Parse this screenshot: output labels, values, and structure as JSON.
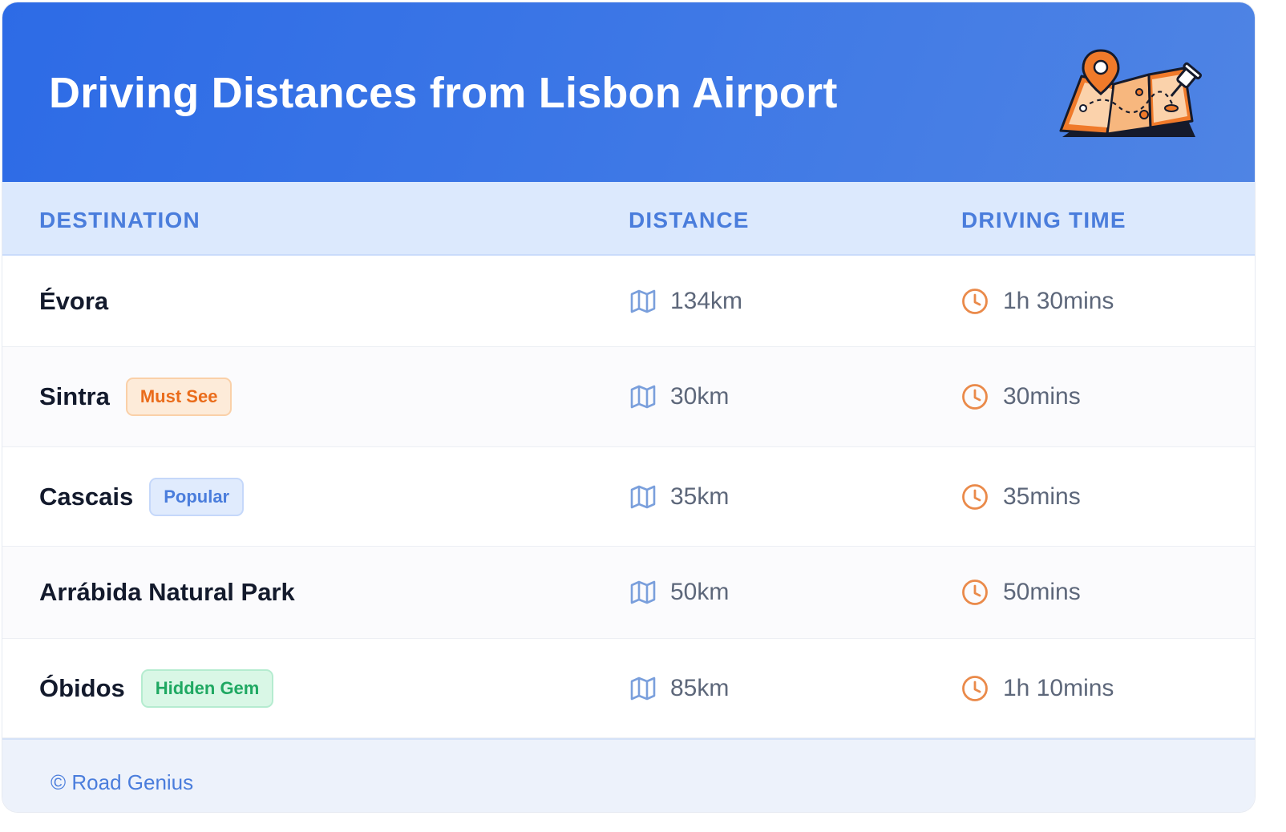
{
  "header": {
    "title": "Driving Distances from Lisbon Airport",
    "illustration_icon": "map-with-pins-icon"
  },
  "table": {
    "columns": [
      "DESTINATION",
      "DISTANCE",
      "DRIVING TIME"
    ],
    "rows": [
      {
        "destination": "Évora",
        "badge": null,
        "distance": "134km",
        "time": "1h 30mins"
      },
      {
        "destination": "Sintra",
        "badge": {
          "label": "Must See",
          "color": "#ea6c1b",
          "bg": "#fdebd9",
          "border": "#fad0a8"
        },
        "distance": "30km",
        "time": "30mins"
      },
      {
        "destination": "Cascais",
        "badge": {
          "label": "Popular",
          "color": "#4a7ddc",
          "bg": "#e0ebfd",
          "border": "#c5d8fa"
        },
        "distance": "35km",
        "time": "35mins"
      },
      {
        "destination": "Arrábida Natural Park",
        "badge": null,
        "distance": "50km",
        "time": "50mins"
      },
      {
        "destination": "Óbidos",
        "badge": {
          "label": "Hidden Gem",
          "color": "#1fa862",
          "bg": "#d9f7e6",
          "border": "#b5ecd0"
        },
        "distance": "85km",
        "time": "1h 10mins"
      }
    ],
    "distance_icon": "map-icon",
    "time_icon": "clock-icon"
  },
  "footer": {
    "text": "© Road Genius"
  },
  "colors": {
    "header_bg": "#2d6be6",
    "header_text": "#ffffff",
    "column_header": "#4a7ddc",
    "accent_orange": "#ea8a4a",
    "map_icon": "#7a9fdc"
  }
}
